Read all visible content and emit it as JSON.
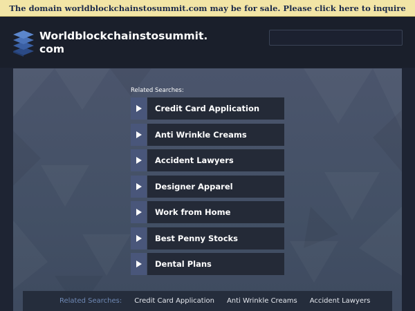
{
  "banner": {
    "text": "The domain worldblockchainstosummit.com may be for sale. Please click here to inquire"
  },
  "header": {
    "site_title": "Worldblockchainstosummit.com",
    "logo_icon": "stacked-layers-icon",
    "search": {
      "value": "",
      "placeholder": ""
    }
  },
  "main": {
    "related_label": "Related Searches:",
    "links": [
      {
        "label": "Credit Card Application",
        "icon": "play-arrow-icon"
      },
      {
        "label": "Anti Wrinkle Creams",
        "icon": "play-arrow-icon"
      },
      {
        "label": "Accident Lawyers",
        "icon": "play-arrow-icon"
      },
      {
        "label": "Designer Apparel",
        "icon": "play-arrow-icon"
      },
      {
        "label": "Work from Home",
        "icon": "play-arrow-icon"
      },
      {
        "label": "Best Penny Stocks",
        "icon": "play-arrow-icon"
      },
      {
        "label": "Dental Plans",
        "icon": "play-arrow-icon"
      }
    ]
  },
  "footer": {
    "related_label": "Related Searches:",
    "links": [
      "Credit Card Application",
      "Anti Wrinkle Creams",
      "Accident Lawyers"
    ]
  },
  "colors": {
    "banner_bg": "#f2e5a6",
    "banner_text": "#1c2a4a",
    "page_bg": "#1e2433",
    "panel_bg": "#4b556c",
    "link_bg": "#242a37",
    "arrow_bg": "#49567a",
    "footer_label": "#6f89b5"
  }
}
